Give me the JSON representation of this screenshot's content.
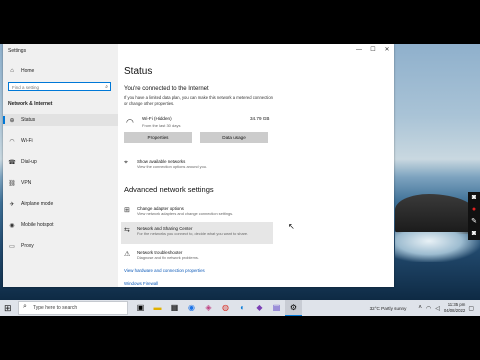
{
  "window": {
    "title": "Settings",
    "controls": [
      "—",
      "☐",
      "✕"
    ]
  },
  "nav": {
    "home": "Home",
    "search_placeholder": "Find a setting",
    "section": "Network & Internet",
    "items": [
      "Status",
      "Wi-Fi",
      "Dial-up",
      "VPN",
      "Airplane mode",
      "Mobile hotspot",
      "Proxy"
    ]
  },
  "main": {
    "heading": "Status",
    "connected_heading": "You're connected to the Internet",
    "metered_text": "If you have a limited data plan, you can make this network a metered connection or change other properties.",
    "wifi": {
      "name": "Wi-Fi (Hidden)",
      "sub": "From the last 30 days",
      "usage": "34.79 GB"
    },
    "buttons": {
      "properties": "Properties",
      "data_usage": "Data usage"
    },
    "show_networks": {
      "title": "Show available networks",
      "sub": "View the connection options around you."
    },
    "advanced_heading": "Advanced network settings",
    "adapter": {
      "title": "Change adapter options",
      "sub": "View network adapters and change connection settings."
    },
    "sharing": {
      "title": "Network and Sharing Center",
      "sub": "For the networks you connect to, decide what you want to share."
    },
    "troubleshooter": {
      "title": "Network troubleshooter",
      "sub": "Diagnose and fix network problems."
    },
    "link_hardware": "View hardware and connection properties",
    "link_firewall": "Windows Firewall"
  },
  "taskbar": {
    "search_placeholder": "Type here to search",
    "weather": "32°C  Partly sunny",
    "time": "11:35 pm",
    "date": "04/08/2022"
  },
  "colors": {
    "accent": "#0078d7",
    "link": "#0b59b8"
  }
}
